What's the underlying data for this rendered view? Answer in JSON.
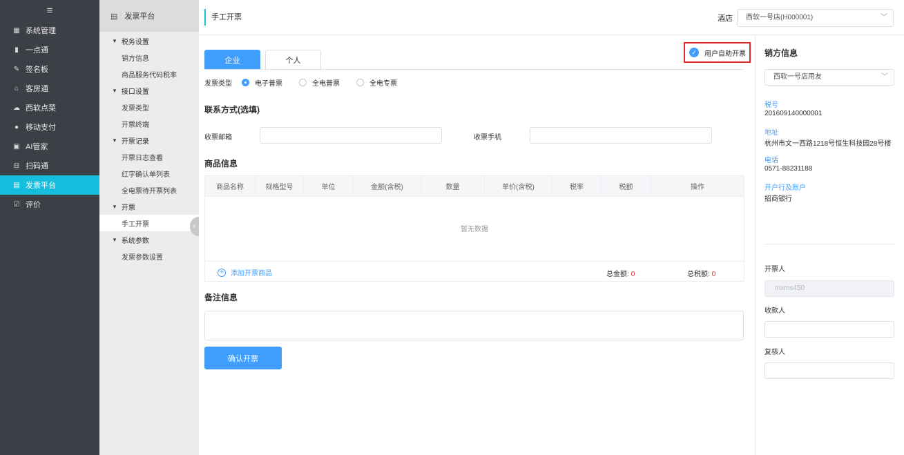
{
  "nav": {
    "items": [
      {
        "label": "系统管理",
        "icon": "grid-icon"
      },
      {
        "label": "一点通",
        "icon": "bar-chart-icon"
      },
      {
        "label": "签名板",
        "icon": "pen-icon"
      },
      {
        "label": "客房通",
        "icon": "home-icon"
      },
      {
        "label": "西软点菜",
        "icon": "cloud-icon"
      },
      {
        "label": "移动支付",
        "icon": "pay-icon"
      },
      {
        "label": "AI管家",
        "icon": "bag-icon"
      },
      {
        "label": "扫码通",
        "icon": "scan-icon"
      },
      {
        "label": "发票平台",
        "icon": "invoice-icon"
      },
      {
        "label": "评价",
        "icon": "edit-icon"
      }
    ],
    "active": "发票平台"
  },
  "submenu": {
    "title": "发票平台",
    "groups": [
      {
        "label": "税务设置",
        "items": [
          "销方信息",
          "商品服务代码税率"
        ]
      },
      {
        "label": "接口设置",
        "items": [
          "发票类型",
          "开票终端"
        ]
      },
      {
        "label": "开票记录",
        "items": [
          "开票日志查看",
          "红字确认单列表",
          "全电票待开票列表"
        ]
      },
      {
        "label": "开票",
        "items": [
          "手工开票"
        ]
      },
      {
        "label": "系统参数",
        "items": [
          "发票参数设置"
        ]
      }
    ],
    "active_item": "手工开票"
  },
  "header": {
    "page_title": "手工开票",
    "hotel_label": "酒店",
    "hotel_value": "西软一号店(H000001)"
  },
  "tabs": {
    "enterprise": "企业",
    "personal": "个人"
  },
  "self_invoice_label": "用户自助开票",
  "invoice_type": {
    "label": "发票类型",
    "options": [
      "电子普票",
      "全电普票",
      "全电专票"
    ],
    "selected": "电子普票"
  },
  "contact": {
    "title": "联系方式(选填)",
    "email_label": "收票邮箱",
    "phone_label": "收票手机"
  },
  "goods": {
    "title": "商品信息",
    "columns": [
      "商品名称",
      "规格型号",
      "单位",
      "金额(含税)",
      "数量",
      "单价(含税)",
      "税率",
      "税额",
      "操作"
    ],
    "empty_text": "暂无数据",
    "add_label": "添加开票商品",
    "total_amount_label": "总金额:",
    "total_amount": "0",
    "total_tax_label": "总税额:",
    "total_tax": "0"
  },
  "remark": {
    "title": "备注信息"
  },
  "confirm_button": "确认开票",
  "seller": {
    "title": "销方信息",
    "select_value": "西软一号店用友",
    "tax_no_label": "税号",
    "tax_no": "201609140000001",
    "address_label": "地址",
    "address": "杭州市文一西路1218号恒生科技园28号楼",
    "phone_label": "电话",
    "phone": "0571-88231188",
    "bank_label": "开户行及账户",
    "bank": "招商银行"
  },
  "signers": {
    "drawer_label": "开票人",
    "drawer_value": "mxms450",
    "payee_label": "收款人",
    "reviewer_label": "复核人"
  },
  "colors": {
    "accent": "#409eff",
    "nav_active": "#14bedc",
    "nav_bg": "#3c3f46",
    "highlight_border": "#e0292a"
  }
}
